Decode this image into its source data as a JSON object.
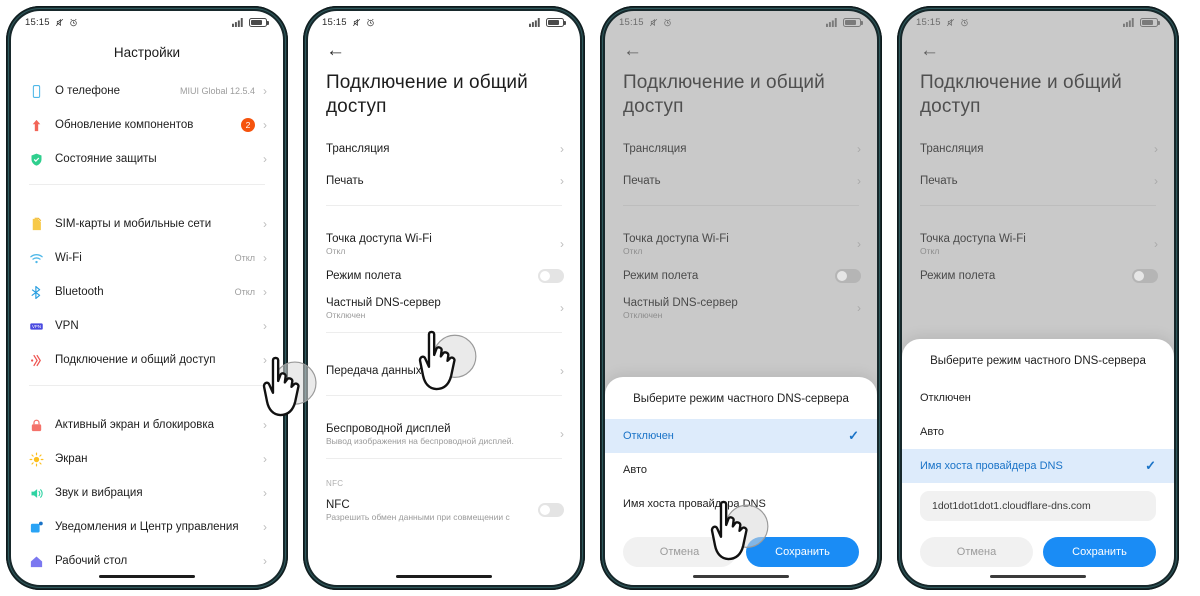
{
  "statusbar": {
    "time": "15:15",
    "icons": [
      "mute-icon",
      "alarm-icon"
    ],
    "signal": "signal-icon",
    "battery": "battery-icon"
  },
  "phone1": {
    "title": "Настройки",
    "items": [
      {
        "icon": "phone-outline-icon",
        "label": "О телефоне",
        "value": "MIUI Global 12.5.4",
        "chevron": "›"
      },
      {
        "icon": "up-arrow-icon",
        "label": "Обновление компонентов",
        "badge": "2",
        "chevron": "›"
      },
      {
        "icon": "shield-check-icon",
        "label": "Состояние защиты",
        "chevron": "›"
      },
      {
        "icon": "sim-card-icon",
        "label": "SIM-карты и мобильные сети",
        "chevron": "›"
      },
      {
        "icon": "wifi-icon",
        "label": "Wi-Fi",
        "value": "Откл",
        "chevron": "›"
      },
      {
        "icon": "bluetooth-icon",
        "label": "Bluetooth",
        "value": "Откл",
        "chevron": "›"
      },
      {
        "icon": "vpn-icon",
        "label": "VPN",
        "chevron": "›"
      },
      {
        "icon": "sharing-icon",
        "label": "Подключение и общий доступ",
        "chevron": "›"
      },
      {
        "icon": "lock-icon",
        "label": "Активный экран и блокировка",
        "chevron": "›"
      },
      {
        "icon": "brightness-icon",
        "label": "Экран",
        "chevron": "›"
      },
      {
        "icon": "sound-icon",
        "label": "Звук и вибрация",
        "chevron": "›"
      },
      {
        "icon": "notifications-icon",
        "label": "Уведомления и Центр управления",
        "chevron": "›"
      },
      {
        "icon": "home-icon",
        "label": "Рабочий стол",
        "chevron": "›"
      }
    ]
  },
  "phone2": {
    "back": "←",
    "title": "Подключение и общий доступ",
    "items": [
      {
        "label": "Трансляция",
        "chevron": "›"
      },
      {
        "label": "Печать",
        "chevron": "›"
      },
      {
        "label": "Точка доступа Wi-Fi",
        "sub": "Откл",
        "chevron": "›"
      },
      {
        "label": "Режим полета",
        "toggle": "off"
      },
      {
        "label": "Частный DNS-сервер",
        "sub": "Отключен",
        "chevron": "›"
      },
      {
        "label": "Передача данных",
        "chevron": "›"
      },
      {
        "label": "Беспроводной дисплей",
        "sub": "Вывод изображения на беспроводной дисплей.",
        "chevron": "›"
      }
    ],
    "nfc_section_label": "NFC",
    "nfc_item": {
      "label": "NFC",
      "sub": "Разрешить обмен данными при совмещении с",
      "toggle": "off"
    }
  },
  "phone3": {
    "back": "←",
    "title": "Подключение и общий доступ",
    "items": [
      {
        "label": "Трансляция",
        "chevron": "›"
      },
      {
        "label": "Печать",
        "chevron": "›"
      },
      {
        "label": "Точка доступа Wi-Fi",
        "sub": "Откл",
        "chevron": "›"
      },
      {
        "label": "Режим полета",
        "toggle": "off"
      },
      {
        "label": "Частный DNS-сервер",
        "sub": "Отключен",
        "chevron": "›"
      }
    ],
    "dialog": {
      "title": "Выберите режим частного DNS-сервера",
      "options": [
        {
          "label": "Отключен",
          "selected": true,
          "check": "✓"
        },
        {
          "label": "Авто",
          "selected": false
        },
        {
          "label": "Имя хоста провайдера DNS",
          "selected": false
        }
      ],
      "cancel_label": "Отмена",
      "save_label": "Сохранить"
    }
  },
  "phone4": {
    "back": "←",
    "title": "Подключение и общий доступ",
    "items": [
      {
        "label": "Трансляция",
        "chevron": "›"
      },
      {
        "label": "Печать",
        "chevron": "›"
      },
      {
        "label": "Точка доступа Wi-Fi",
        "sub": "Откл",
        "chevron": "›"
      },
      {
        "label": "Режим полета",
        "toggle": "off"
      }
    ],
    "dialog": {
      "title": "Выберите режим частного DNS-сервера",
      "options": [
        {
          "label": "Отключен",
          "selected": false
        },
        {
          "label": "Авто",
          "selected": false
        },
        {
          "label": "Имя хоста провайдера DNS",
          "selected": true,
          "check": "✓"
        }
      ],
      "input_value": "1dot1dot1dot1.cloudflare-dns.com",
      "cancel_label": "Отмена",
      "save_label": "Сохранить"
    }
  },
  "colors": {
    "accent_blue": "#1a8cf5",
    "selected_row_bg": "#ddebfb",
    "selected_text": "#1a73c7",
    "badge_orange": "#f5530d",
    "frame": "#17282b"
  }
}
